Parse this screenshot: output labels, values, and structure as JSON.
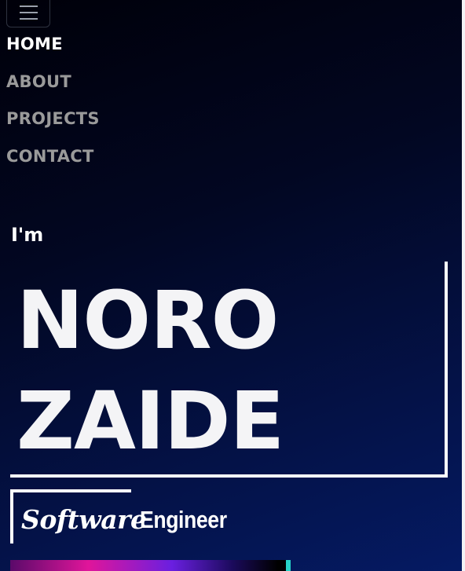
{
  "nav": {
    "items": [
      {
        "label": "HOME",
        "active": true
      },
      {
        "label": "ABOUT",
        "active": false
      },
      {
        "label": "PROJECTS",
        "active": false
      },
      {
        "label": "CONTACT",
        "active": false
      }
    ],
    "toggle_icon": "hamburger-menu-icon"
  },
  "hero": {
    "intro": "I'm",
    "name_line_1": "NORO",
    "name_line_2": "ZAIDE",
    "role_word_1": "Software",
    "role_word_2": "Engineer"
  },
  "colors": {
    "background_top": "#000009",
    "background_bottom": "#051a63",
    "nav_active": "#ffffff",
    "nav_inactive": "#9a9a9a",
    "accent_pink": "#e0159a",
    "accent_purple": "#6a1fe0",
    "accent_teal": "#27d3c8"
  }
}
